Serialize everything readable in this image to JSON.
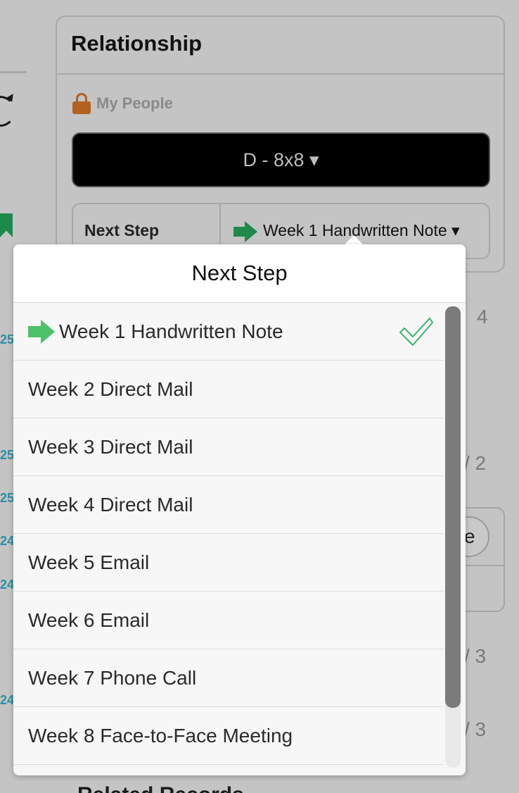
{
  "background": {
    "numbers_left": [
      "25",
      "25",
      "25",
      "24",
      "24",
      "24"
    ],
    "side_values": [
      "4",
      "/ 2",
      "/ 3",
      "/ 3"
    ],
    "pill_text": "e",
    "bottom_text": "Related Records"
  },
  "relationship": {
    "title": "Relationship",
    "people_label": "My People",
    "group_button": "D - 8x8 ▾",
    "next_step_label": "Next Step",
    "next_step_value": "Week 1 Handwritten Note ▾"
  },
  "popover": {
    "title": "Next Step",
    "items": [
      {
        "label": "Week 1 Handwritten Note",
        "selected": true
      },
      {
        "label": "Week 2 Direct Mail"
      },
      {
        "label": "Week 3 Direct Mail"
      },
      {
        "label": "Week 4 Direct Mail"
      },
      {
        "label": "Week 5 Email"
      },
      {
        "label": "Week 6 Email"
      },
      {
        "label": "Week 7 Phone Call"
      },
      {
        "label": "Week 8 Face-to-Face Meeting"
      }
    ]
  },
  "colors": {
    "arrow_green": "#1f8a4c",
    "selected_arrow_green": "#4cc16a",
    "check_green": "#3bb56a",
    "lock_orange": "#b4601e",
    "link_teal": "#2b8fa5"
  },
  "icons": {
    "selected_item": "arrow-right-icon",
    "checkmark": "check-icon",
    "lock": "lock-icon"
  }
}
